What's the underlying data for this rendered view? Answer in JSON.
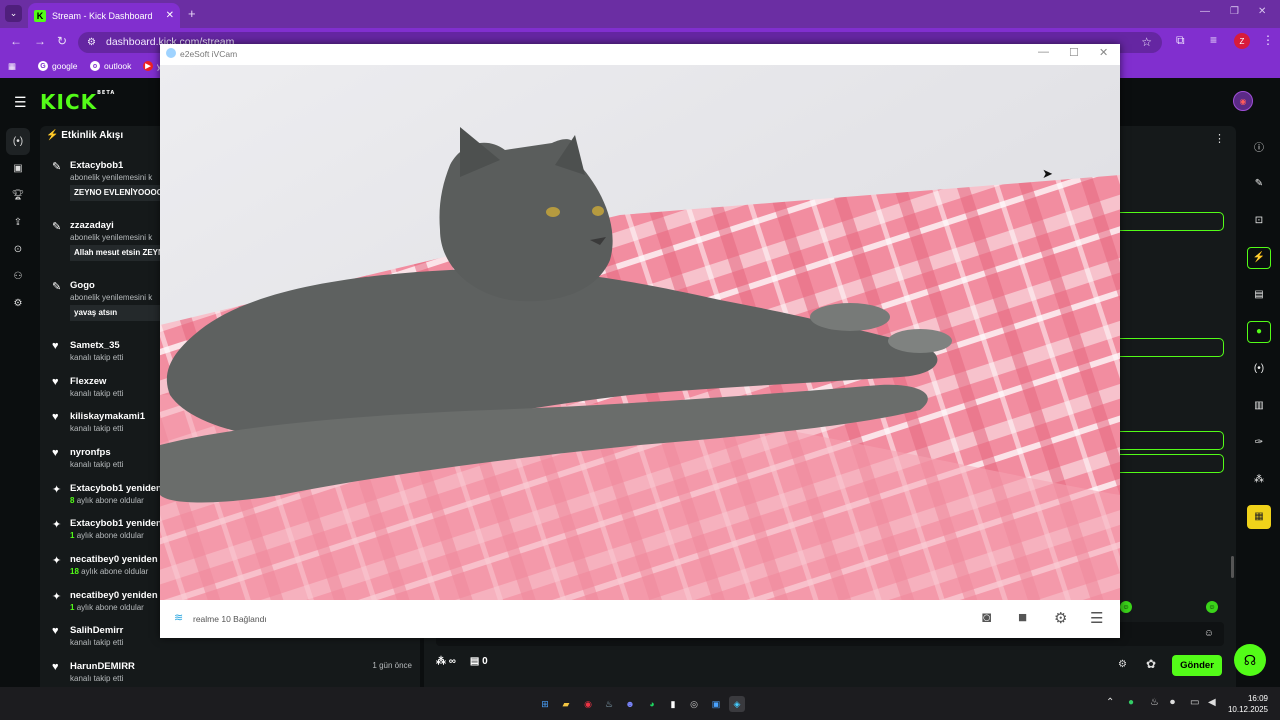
{
  "browser": {
    "tab_title": "Stream - Kick Dashboard",
    "url": "dashboard.kick.com/stream",
    "bookmarks": [
      "google",
      "outlook",
      "y"
    ],
    "profile_initial": "Z"
  },
  "kick": {
    "logo": "KICK",
    "logo_badge": "BETA",
    "feed_title": "Etkinlik Akışı",
    "events": [
      {
        "icon": "resub-icon",
        "name": "Extacybob1",
        "sub": "abonelik yenilemesini k",
        "message": "ZEYNO EVLENİYOOOO"
      },
      {
        "icon": "resub-icon",
        "name": "zzazadayi",
        "sub": "abonelik yenilemesini k",
        "message": "Allah mesut etsin ZEYN"
      },
      {
        "icon": "resub-icon",
        "name": "Gogo",
        "sub": "abonelik yenilemesini k",
        "message": "yavaş atsın"
      },
      {
        "icon": "heart-icon",
        "name": "Sametx_35",
        "sub": "kanalı takip etti"
      },
      {
        "icon": "heart-icon",
        "name": "Flexzew",
        "sub": "kanalı takip etti"
      },
      {
        "icon": "heart-icon",
        "name": "kiliskaymakami1",
        "sub": "kanalı takip etti"
      },
      {
        "icon": "heart-icon",
        "name": "nyronfps",
        "sub": "kanalı takip etti"
      },
      {
        "icon": "sparkle-icon",
        "name": "Extacybob1 yeniden",
        "count": "8",
        "sub": "aylık abone oldular"
      },
      {
        "icon": "sparkle-icon",
        "name": "Extacybob1 yeniden",
        "count": "1",
        "sub": "aylık abone oldular"
      },
      {
        "icon": "sparkle-icon",
        "name": "necatibey0 yeniden",
        "count": "18",
        "sub": "aylık abone oldular"
      },
      {
        "icon": "sparkle-icon",
        "name": "necatibey0 yeniden",
        "count": "1",
        "sub": "aylık abone oldular"
      },
      {
        "icon": "heart-icon",
        "name": "SalihDemirr",
        "sub": "kanalı takip etti"
      },
      {
        "icon": "heart-icon",
        "name": "HarunDEMIRR",
        "sub": "kanalı takip etti",
        "ago": "1 gün önce"
      }
    ],
    "chat": {
      "send_label": "Gönder",
      "points_label": "0",
      "infinite_label": "∞"
    }
  },
  "ivcam": {
    "title": "e2eSoft iVCam",
    "device_status": "realme 10 Bağlandı"
  },
  "taskbar": {
    "time": "16:09",
    "date": "10.12.2025"
  }
}
